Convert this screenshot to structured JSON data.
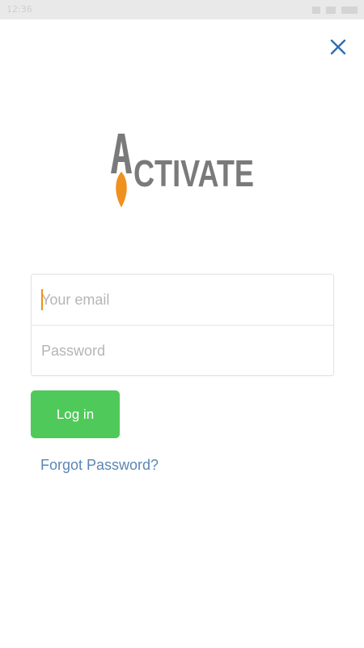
{
  "status_bar": {
    "time": "12:36"
  },
  "header": {
    "close_icon": "close-icon"
  },
  "logo": {
    "text": "ACTIVATE",
    "letter_color": "#7a7a7a",
    "flame_color": "#f0901e"
  },
  "login_form": {
    "email_placeholder": "Your email",
    "email_value": "",
    "password_placeholder": "Password",
    "password_value": ""
  },
  "actions": {
    "login_label": "Log in",
    "forgot_label": "Forgot Password?"
  },
  "colors": {
    "accent_blue": "#2f6db5",
    "button_green": "#4fc95a",
    "link_blue": "#5b86b5",
    "cursor_orange": "#f0901e"
  }
}
